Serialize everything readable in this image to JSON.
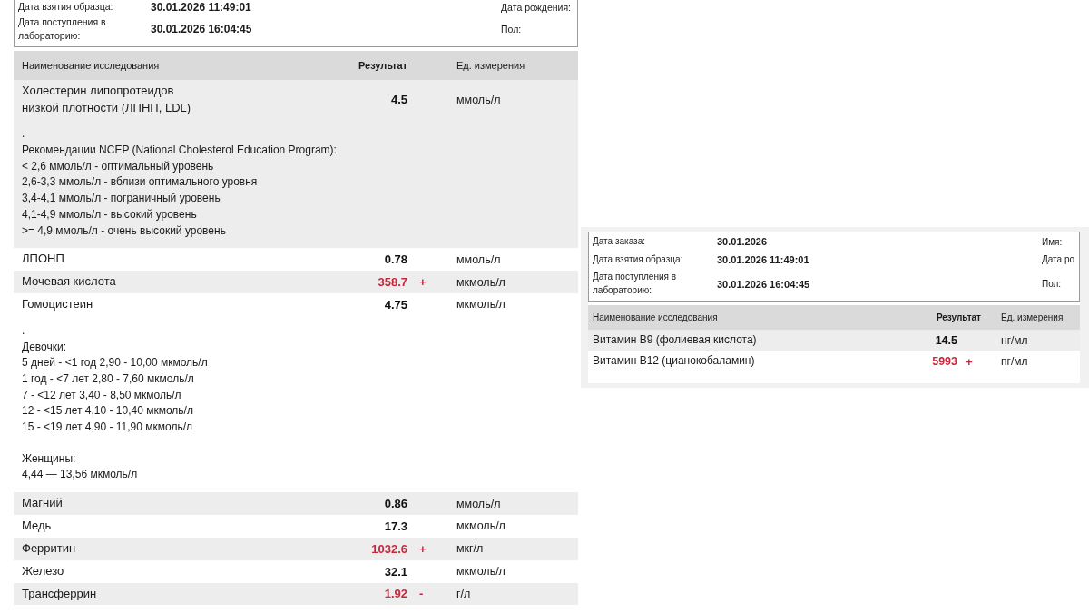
{
  "left_report": {
    "info": [
      {
        "label": "Дата взятия образца:",
        "value": "30.01.2026 11:49:01",
        "side_label": "Дата рождения:"
      },
      {
        "label": "Дата поступления в лабораторию:",
        "value": "30.01.2026 16:04:45",
        "side_label": "Пол:"
      }
    ],
    "columns": [
      "Наименование исследования",
      "Результат",
      "Ед. измерения"
    ],
    "rows": [
      {
        "name": "Холестерин липопротеидов низкой плотности (ЛПНП, LDL)",
        "value": "4.5",
        "unit": "ммоль/л",
        "abnormal": false,
        "note": [
          [
            ".",
            "Рекомендации NCEP (National Cholesterol Education Program):",
            "< 2,6 ммоль/л - оптимальный уровень",
            "2,6-3,3 ммоль/л - вблизи оптимального уровня",
            "3,4-4,1 ммоль/л - пограничный уровень",
            "4,1-4,9 ммоль/л - высокий уровень",
            ">= 4,9 ммоль/л - очень высокий уровень"
          ]
        ]
      },
      {
        "name": "ЛПОНП",
        "value": "0.78",
        "unit": "ммоль/л",
        "abnormal": false
      },
      {
        "name": "Мочевая кислота",
        "value": "358.7",
        "flag": "+",
        "unit": "мкмоль/л",
        "abnormal": true
      },
      {
        "name": "Гомоцистеин",
        "value": "4.75",
        "unit": "мкмоль/л",
        "abnormal": false,
        "note": [
          [
            ".",
            "Девочки:",
            "5 дней - <1 год 2,90 - 10,00 мкмоль/л",
            "1 год - <7 лет 2,80 - 7,60 мкмоль/л",
            "7 - <12 лет 3,40 - 8,50 мкмоль/л",
            "12 - <15 лет 4,10 - 10,40 мкмоль/л",
            "15 - <19 лет 4,90 - 11,90 мкмоль/л"
          ],
          [
            "Женщины:",
            "4,44 — 13,56 мкмоль/л"
          ]
        ]
      },
      {
        "name": "Магний",
        "value": "0.86",
        "unit": "ммоль/л",
        "abnormal": false
      },
      {
        "name": "Медь",
        "value": "17.3",
        "unit": "мкмоль/л",
        "abnormal": false
      },
      {
        "name": "Ферритин",
        "value": "1032.6",
        "flag": "+",
        "unit": "мкг/л",
        "abnormal": true
      },
      {
        "name": "Железо",
        "value": "32.1",
        "unit": "мкмоль/л",
        "abnormal": false
      },
      {
        "name": "Трансферрин",
        "value": "1.92",
        "flag": "-",
        "unit": "г/л",
        "abnormal": true
      }
    ]
  },
  "right_report": {
    "info": [
      {
        "label": "Дата заказа:",
        "value": "30.01.2026",
        "side_label": "Имя:"
      },
      {
        "label": "Дата взятия образца:",
        "value": "30.01.2026 11:49:01",
        "side_label": "Дата ро"
      },
      {
        "label": "Дата поступления в лабораторию:",
        "value": "30.01.2026 16:04:45",
        "side_label": "Пол:"
      }
    ],
    "columns": [
      "Наименование исследования",
      "Результат",
      "Ед. измерения"
    ],
    "rows": [
      {
        "name": "Витамин B9 (фолиевая кислота)",
        "value": "14.5",
        "unit": "нг/мл",
        "abnormal": false
      },
      {
        "name": "Витамин B12 (цианокобаламин)",
        "value": "5993",
        "flag": "+",
        "unit": "пг/мл",
        "abnormal": true
      }
    ]
  }
}
